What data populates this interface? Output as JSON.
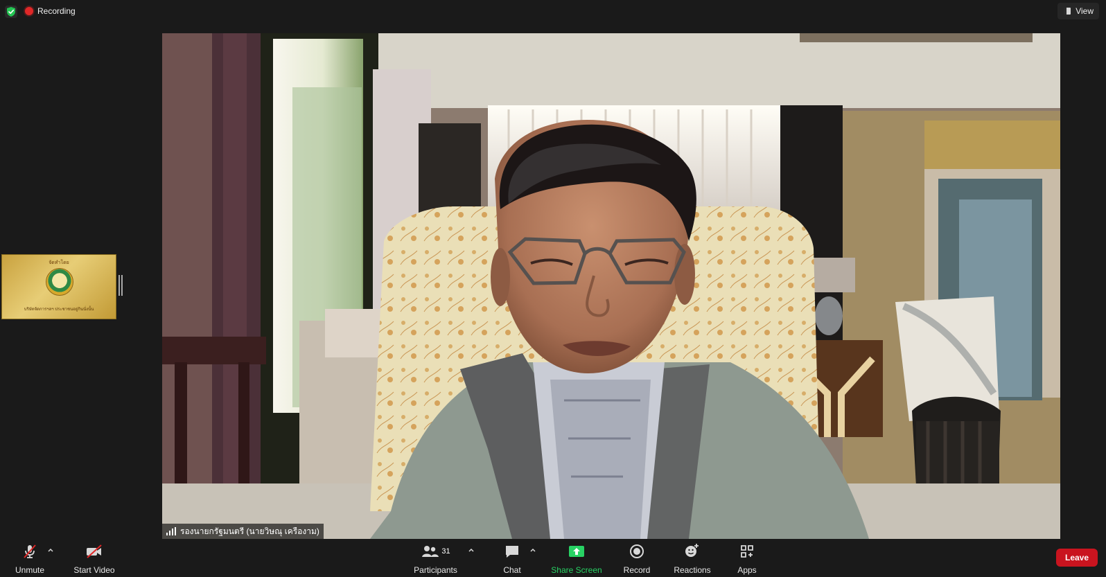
{
  "topbar": {
    "recording_label": "Recording",
    "view_label": "View",
    "icons": {
      "security": "shield-check-icon",
      "recording": "recording-dot-icon",
      "view": "view-icon"
    }
  },
  "thumbnail": {
    "top_text": "จัดทำโดย",
    "bottom_text": "บริษัทจัดการฯลฯ ประชาชนอยู่กินนั่งนั้น",
    "logo": "emblem-logo"
  },
  "main_video": {
    "participant_name": "รองนายกรัฐมนตรี (นายวิษณุ เครืองาม)",
    "signal_icon": "signal-bars-icon"
  },
  "toolbar": {
    "unmute_label": "Unmute",
    "start_video_label": "Start Video",
    "participants_label": "Participants",
    "participants_count": "31",
    "chat_label": "Chat",
    "share_screen_label": "Share Screen",
    "record_label": "Record",
    "reactions_label": "Reactions",
    "apps_label": "Apps",
    "leave_label": "Leave"
  },
  "colors": {
    "background": "#1a1a1a",
    "recording_red": "#e02828",
    "share_green": "#28d264",
    "leave_red": "#c9141f",
    "security_green": "#23c552"
  }
}
